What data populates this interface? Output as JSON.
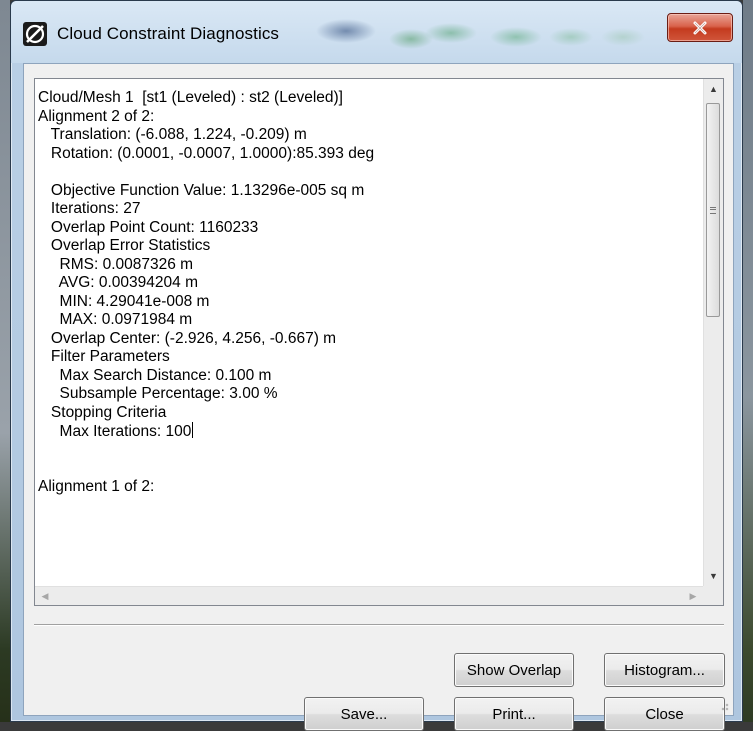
{
  "window": {
    "title": "Cloud Constraint Diagnostics"
  },
  "diagnostics": {
    "lines": [
      "Cloud/Mesh 1  [st1 (Leveled) : st2 (Leveled)]",
      "Alignment 2 of 2:",
      "   Translation: (-6.088, 1.224, -0.209) m",
      "   Rotation: (0.0001, -0.0007, 1.0000):85.393 deg",
      "",
      "   Objective Function Value: 1.13296e-005 sq m",
      "   Iterations: 27",
      "   Overlap Point Count: 1160233",
      "   Overlap Error Statistics",
      "     RMS: 0.0087326 m",
      "     AVG: 0.00394204 m",
      "     MIN: 4.29041e-008 m",
      "     MAX: 0.0971984 m",
      "   Overlap Center: (-2.926, 4.256, -0.667) m",
      "   Filter Parameters",
      "     Max Search Distance: 0.100 m",
      "     Subsample Percentage: 3.00 %",
      "   Stopping Criteria",
      "     Max Iterations: 100",
      "",
      "",
      "Alignment 1 of 2:"
    ]
  },
  "buttons": {
    "show_overlap": "Show Overlap",
    "histogram": "Histogram...",
    "save": "Save...",
    "print": "Print...",
    "close": "Close"
  },
  "icons": {
    "app": "cyclone-logo-icon",
    "close": "close-icon"
  },
  "colors": {
    "close_button": "#c43b1f",
    "title_bar": "#c5d9ec"
  }
}
